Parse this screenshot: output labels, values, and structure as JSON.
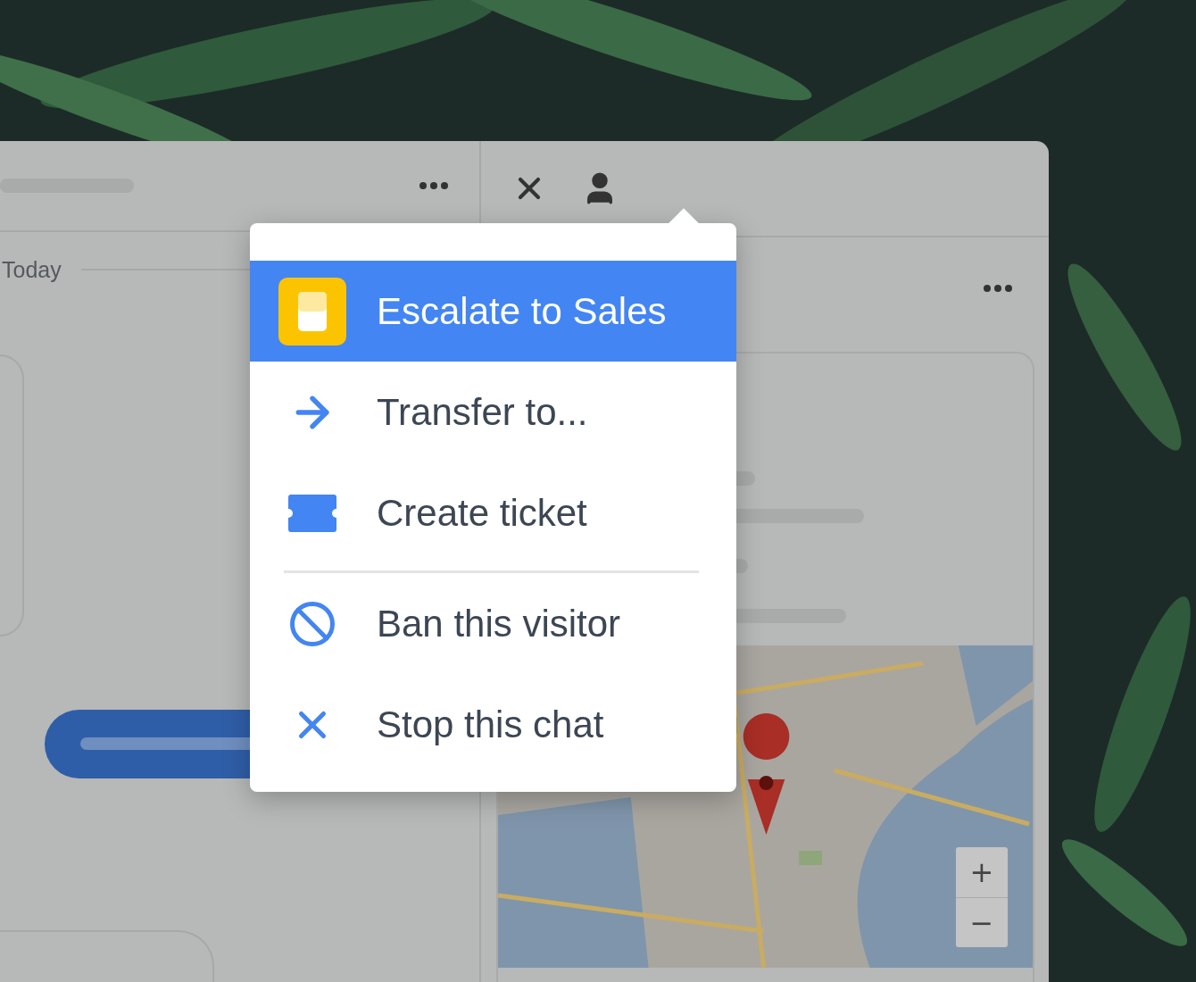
{
  "left_panel": {
    "divider_label": "Today"
  },
  "context_menu": {
    "items": [
      {
        "label": "Escalate to Sales",
        "kind": "escalate",
        "selected": true,
        "divider_before": false
      },
      {
        "label": "Transfer to...",
        "kind": "arrow",
        "selected": false,
        "divider_before": false
      },
      {
        "label": "Create ticket",
        "kind": "ticket",
        "selected": false,
        "divider_before": false
      },
      {
        "label": "Ban this visitor",
        "kind": "ban",
        "selected": false,
        "divider_before": true
      },
      {
        "label": "Stop this chat",
        "kind": "cross",
        "selected": false,
        "divider_before": false
      }
    ]
  },
  "map": {
    "kind": "picture",
    "zoom_controls": [
      "+",
      "−"
    ]
  }
}
